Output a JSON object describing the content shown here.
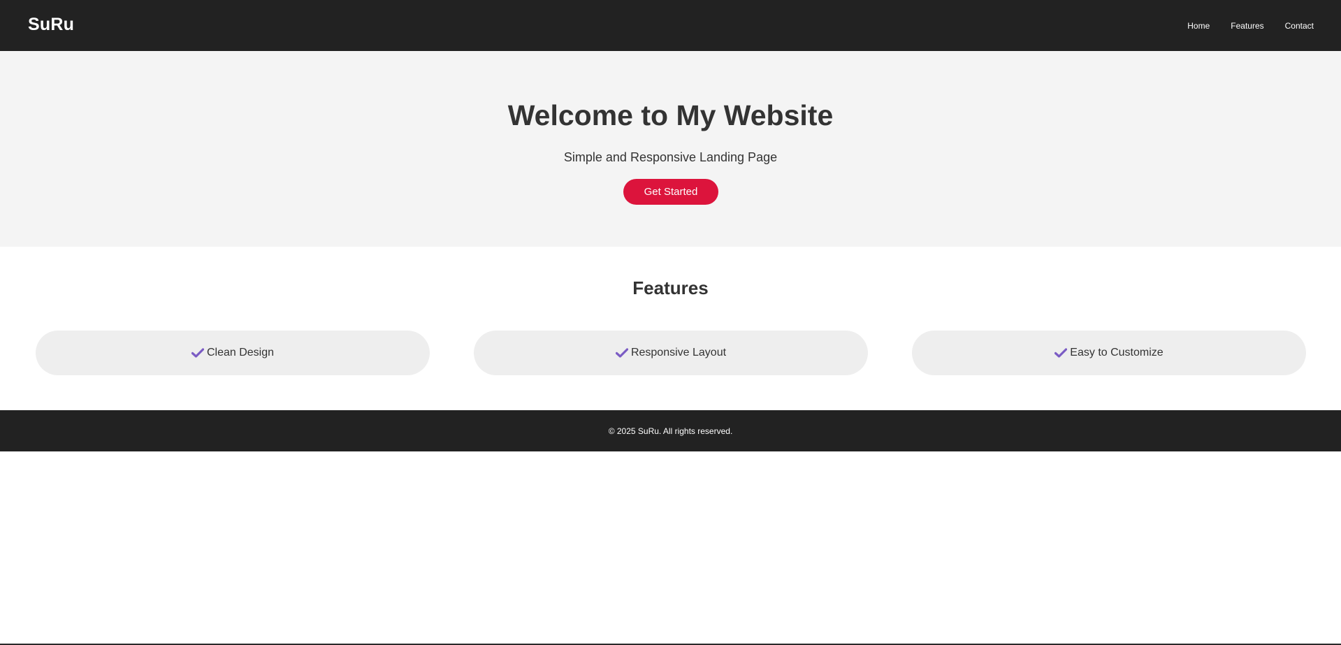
{
  "header": {
    "logo": "SuRu",
    "nav": [
      {
        "label": "Home"
      },
      {
        "label": "Features"
      },
      {
        "label": "Contact"
      }
    ]
  },
  "hero": {
    "title": "Welcome to My Website",
    "subtitle": "Simple and Responsive Landing Page",
    "button_label": "Get Started"
  },
  "features": {
    "title": "Features",
    "items": [
      {
        "icon": "check-icon",
        "label": "Clean Design"
      },
      {
        "icon": "check-icon",
        "label": "Responsive Layout"
      },
      {
        "icon": "check-icon",
        "label": "Easy to Customize"
      }
    ]
  },
  "footer": {
    "text": "© 2025 SuRu. All rights reserved."
  },
  "colors": {
    "header_bg": "#222222",
    "hero_bg": "#f4f4f4",
    "accent": "#dc143c",
    "card_bg": "#eeeeee",
    "check": "#7b5cc4",
    "text": "#333333"
  }
}
